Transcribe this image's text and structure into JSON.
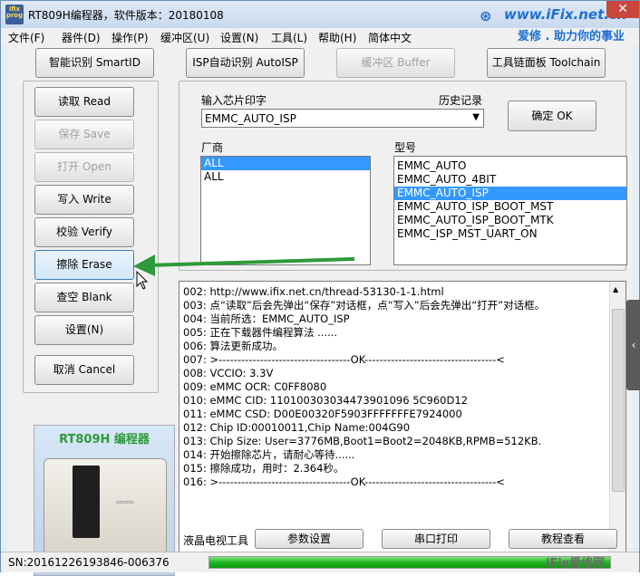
{
  "window": {
    "icon_text": "ifix prog",
    "title": "RT809H编程器，软件版本：20180108",
    "brand_url": "www.iFix.net.cn",
    "brand_slogan": "爱修 . 助力你的事业",
    "close_glyph": "✕"
  },
  "menu": [
    "文件(F)",
    "器件(D)",
    "操作(P)",
    "缓冲区(U)",
    "设置(N)",
    "工具(L)",
    "帮助(H)",
    "简体中文"
  ],
  "toolbar": {
    "smart_id": "智能识别 SmartID",
    "auto_isp": "ISP自动识别 AutoISP",
    "buffer": "缓冲区 Buffer",
    "toolchain": "工具链面板 Toolchain"
  },
  "ops": {
    "read": "读取 Read",
    "save": "保存 Save",
    "open": "打开 Open",
    "write": "写入 Write",
    "verify": "校验 Verify",
    "erase": "擦除 Erase",
    "blank": "查空 Blank",
    "settings": "设置(N)",
    "cancel": "取消 Cancel"
  },
  "device_image_label": "RT809H 编程器",
  "chip": {
    "input_label": "输入芯片印字",
    "history_label": "历史记录",
    "input_value": "EMMC_AUTO_ISP",
    "ok_button": "确定 OK",
    "vendor_label": "厂商",
    "vendors": [
      "ALL",
      "ALL"
    ],
    "vendor_selected": 0,
    "model_label": "型号",
    "models": [
      "EMMC_AUTO",
      "EMMC_AUTO_4BIT",
      "EMMC_AUTO_ISP",
      "EMMC_AUTO_ISP_BOOT_MST",
      "EMMC_AUTO_ISP_BOOT_MTK",
      "EMMC_ISP_MST_UART_ON"
    ],
    "model_selected": 2
  },
  "log": [
    "002:  http://www.ifix.net.cn/thread-53130-1-1.html",
    "003:  点“读取”后会先弹出“保存”对话框，点“写入”后会先弹出“打开”对话框。",
    "004:  当前所选：EMMC_AUTO_ISP",
    "005:  正在下载器件编程算法 ......",
    "006:  算法更新成功。",
    "007:  >-----------------------------------OK-----------------------------------<",
    "008:  VCCIO: 3.3V",
    "009:  eMMC OCR: C0FF8080",
    "010:  eMMC CID:  110100303034473901096 5C960D12",
    "011:  eMMC CSD: D00E00320F5903FFFFFFFE7924000",
    "012:  Chip ID:00010011,Chip Name:004G90",
    "013:  Chip Size: User=3776MB,Boot1=Boot2=2048KB,RPMB=512KB.",
    "014:  开始擦除芯片，请耐心等待......",
    "015:  擦除成功，用时：2.364秒。",
    "016:  >-----------------------------------OK-----------------------------------<"
  ],
  "bottom": {
    "lcd_label": "液晶电视工具",
    "params_button": "参数设置",
    "serial_button": "串口打印",
    "tutorial_button": "教程查看"
  },
  "status": {
    "serial": "SN:20161226193846-006376",
    "progress_fraction": 1.0
  },
  "watermark": "iFix爱修网",
  "colors": {
    "selection": "#3399ff",
    "progress": "#21b521",
    "brand": "#1c6fd4",
    "arrow": "#2e9a3a"
  }
}
